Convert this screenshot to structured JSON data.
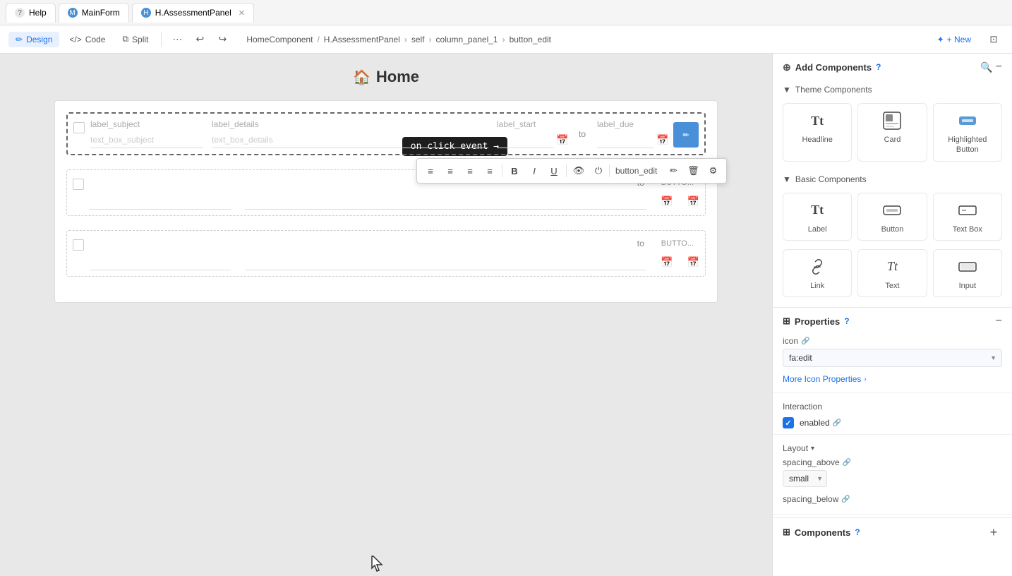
{
  "tabs": [
    {
      "id": "help",
      "label": "Help",
      "icon": "?",
      "iconColor": "#e8e8e8",
      "active": false
    },
    {
      "id": "mainform",
      "label": "MainForm",
      "icon": "M",
      "iconColor": "#4a90d9",
      "active": false
    },
    {
      "id": "assessment",
      "label": "H.AssessmentPanel",
      "icon": "H",
      "iconColor": "#4a90d9",
      "active": true
    }
  ],
  "toolbar": {
    "design_label": "Design",
    "code_label": "Code",
    "split_label": "Split",
    "new_label": "+ New"
  },
  "breadcrumb": {
    "parts": [
      "HomeComponent",
      "H.AssessmentPanel",
      "self",
      "column_panel_1",
      "button_edit"
    ]
  },
  "canvas": {
    "title": "Home",
    "click_event_text": "on click event →"
  },
  "float_toolbar": {
    "button_name": "button_edit"
  },
  "form": {
    "row1": {
      "label_subject": "label_subject",
      "label_details": "label_details",
      "label_start": "label_start",
      "to": "to",
      "label_due": "label_due",
      "text_subject": "text_box_subject",
      "text_details": "text_box_details"
    },
    "row2": {
      "to": "to",
      "button": "BUTTO..."
    },
    "row3": {
      "to": "to",
      "button": "BUTTO..."
    }
  },
  "right_panel": {
    "add_components_title": "Add Components",
    "theme_components_title": "Theme Components",
    "basic_components_title": "Basic Components",
    "components": {
      "theme": [
        {
          "label": "Headline",
          "icon": "Tt"
        },
        {
          "label": "Card",
          "icon": "⊞"
        },
        {
          "label": "Highlighted Button",
          "icon": "⊡"
        }
      ],
      "basic": [
        {
          "label": "Label",
          "icon": "Tt"
        },
        {
          "label": "Button",
          "icon": "⊡"
        },
        {
          "label": "Text Box",
          "icon": "▭"
        }
      ]
    },
    "properties_title": "Properties",
    "icon_label": "icon",
    "icon_value": "fa:edit",
    "more_icon_properties": "More Icon Properties",
    "interaction_title": "Interaction",
    "enabled_label": "enabled",
    "layout_title": "Layout",
    "spacing_above_label": "spacing_above",
    "spacing_above_value": "small",
    "spacing_below_label": "spacing_below",
    "components_bottom_title": "Components"
  }
}
